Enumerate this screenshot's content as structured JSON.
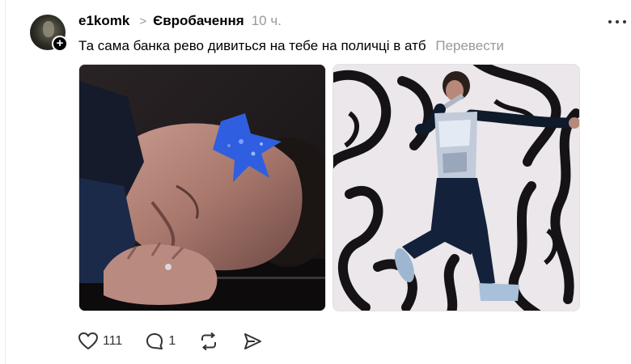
{
  "post": {
    "author": {
      "username": "e1komk",
      "avatar_icon": "user-avatar",
      "follow_icon": "plus-icon"
    },
    "topic": "Євробачення",
    "time": "10 ч.",
    "text": "Та сама банка рево дивиться на тебе на поличці в атб",
    "translate_label": "Перевести",
    "media": [
      {
        "type": "image",
        "icon": "photo-performer-lying-glitter"
      },
      {
        "type": "image",
        "icon": "photo-performer-stage-dance"
      }
    ],
    "actions": {
      "likes": "111",
      "replies": "1",
      "repost_icon": "repost-icon",
      "share_icon": "share-icon"
    }
  },
  "colors": {
    "text": "#000000",
    "muted": "#999999",
    "accent_blue": "#2f5fe0"
  }
}
